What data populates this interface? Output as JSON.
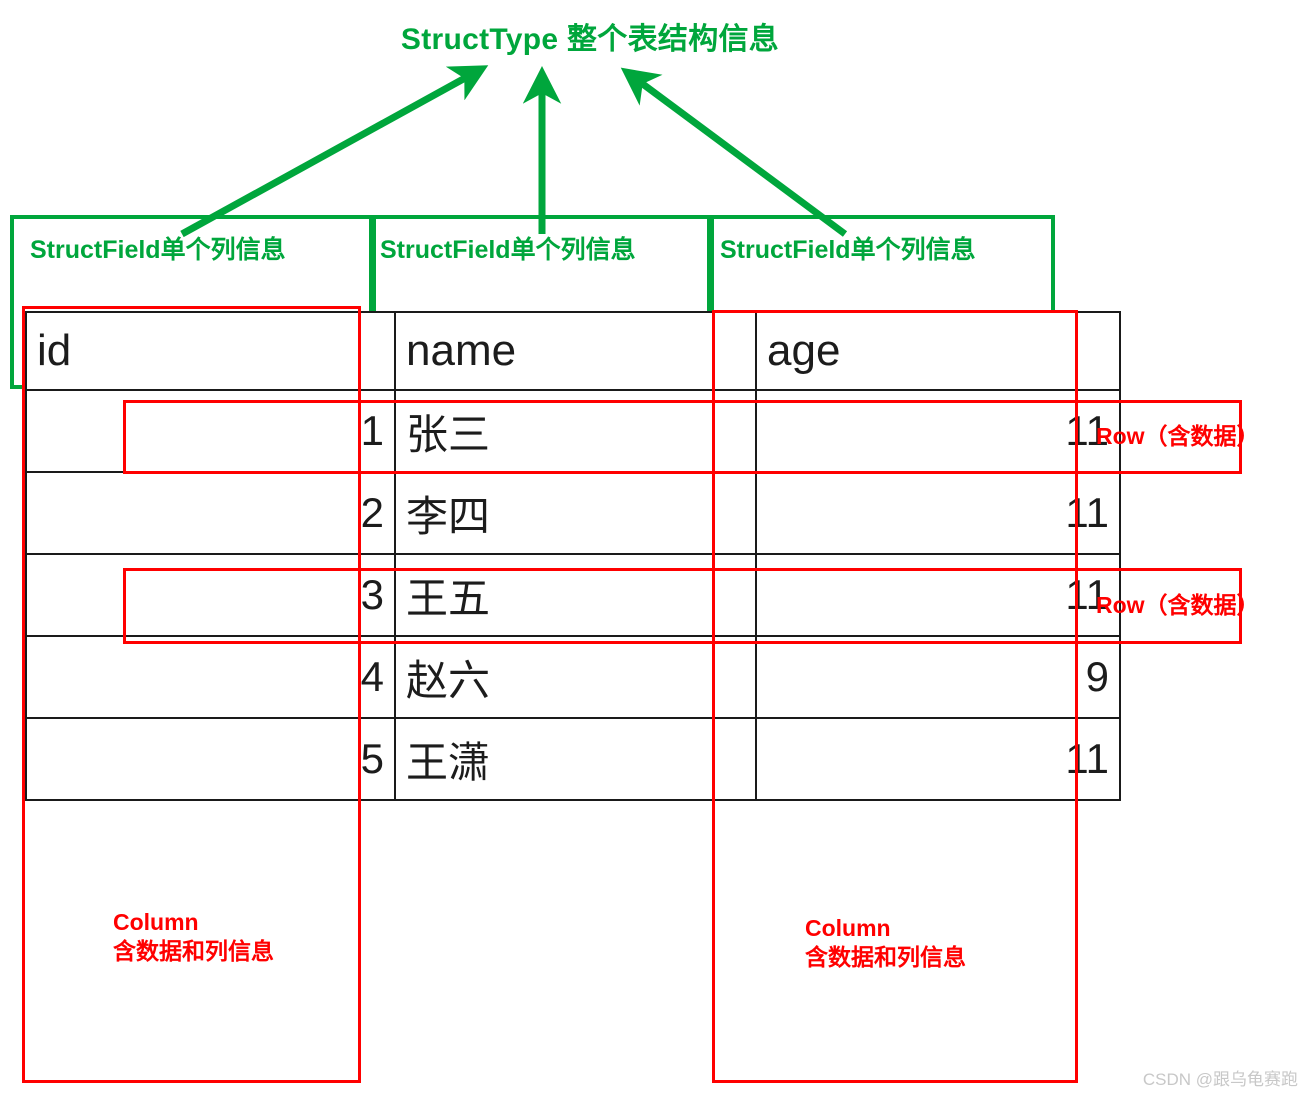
{
  "title": "StructType 整个表结构信息",
  "struct_fields": [
    {
      "label": "StructField单个列信息"
    },
    {
      "label": "StructField单个列信息"
    },
    {
      "label": "StructField单个列信息"
    }
  ],
  "table": {
    "columns": [
      "id",
      "name",
      "age"
    ],
    "rows": [
      {
        "id": "1",
        "name": "张三",
        "age": "11"
      },
      {
        "id": "2",
        "name": "李四",
        "age": "11"
      },
      {
        "id": "3",
        "name": "王五",
        "age": "11"
      },
      {
        "id": "4",
        "name": "赵六",
        "age": "9"
      },
      {
        "id": "5",
        "name": "王潇",
        "age": "11"
      }
    ]
  },
  "annotations": {
    "row_labels": [
      {
        "text": "Row（含数据）"
      },
      {
        "text": "Row（含数据）"
      }
    ],
    "column_labels": [
      {
        "line1": "Column",
        "line2": "含数据和列信息"
      },
      {
        "line1": "Column",
        "line2": "含数据和列信息"
      }
    ]
  },
  "watermark": "CSDN @跟乌龟赛跑",
  "colors": {
    "green": "#00a63c",
    "red": "#ff0000",
    "table_border": "#1a1a1a",
    "watermark": "#c8c8c8"
  }
}
